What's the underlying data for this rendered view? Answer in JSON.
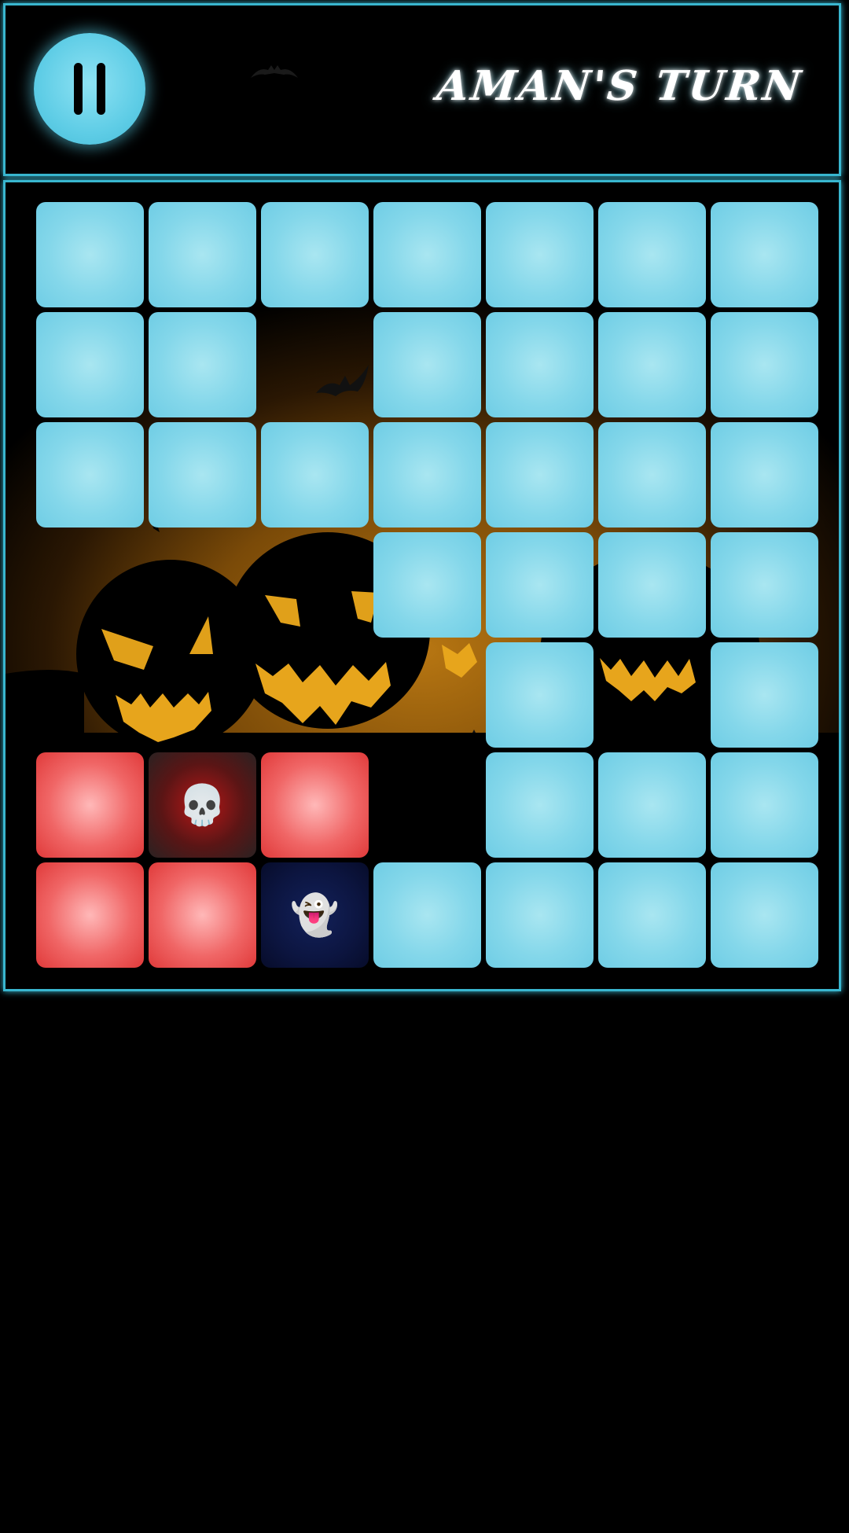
{
  "header": {
    "turn_label": "AMAN'S TURN",
    "pause_icon": "pause-icon"
  },
  "theme": {
    "accent": "#39b6cf",
    "empty_cell": "#84d7ea",
    "player_red": "#f06666",
    "skull_cell": "#b81818",
    "ghost_cell": "#0c1540",
    "background_glow": "#b77612"
  },
  "board": {
    "columns": 7,
    "rows": 7,
    "grid": [
      [
        "empty",
        "empty",
        "empty",
        "empty",
        "empty",
        "empty",
        "empty"
      ],
      [
        "empty",
        "empty",
        "removed",
        "empty",
        "empty",
        "empty",
        "empty"
      ],
      [
        "empty",
        "empty",
        "empty",
        "empty",
        "empty",
        "empty",
        "empty"
      ],
      [
        "removed",
        "removed",
        "removed",
        "empty",
        "empty",
        "empty",
        "empty"
      ],
      [
        "removed",
        "removed",
        "removed",
        "removed",
        "empty",
        "removed",
        "empty"
      ],
      [
        "red",
        "skull",
        "red",
        "removed",
        "empty",
        "empty",
        "empty"
      ],
      [
        "red",
        "red",
        "ghost",
        "empty",
        "empty",
        "empty",
        "empty"
      ]
    ],
    "pieces": {
      "skull": "💀",
      "ghost": "👻"
    }
  }
}
